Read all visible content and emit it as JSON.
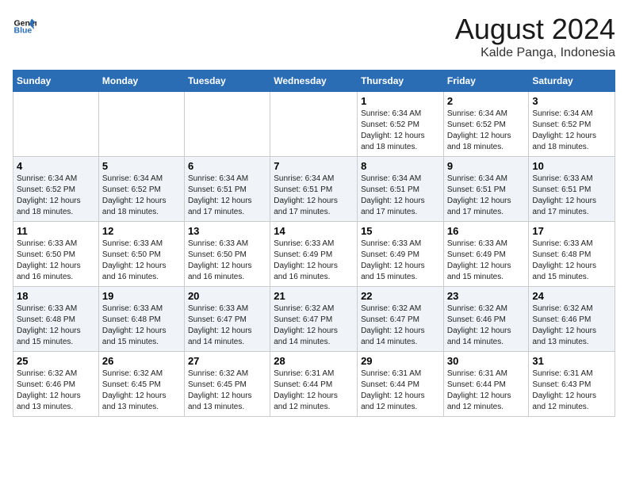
{
  "header": {
    "logo_line1": "General",
    "logo_line2": "Blue",
    "month": "August 2024",
    "location": "Kalde Panga, Indonesia"
  },
  "weekdays": [
    "Sunday",
    "Monday",
    "Tuesday",
    "Wednesday",
    "Thursday",
    "Friday",
    "Saturday"
  ],
  "weeks": [
    [
      {
        "day": "",
        "info": ""
      },
      {
        "day": "",
        "info": ""
      },
      {
        "day": "",
        "info": ""
      },
      {
        "day": "",
        "info": ""
      },
      {
        "day": "1",
        "info": "Sunrise: 6:34 AM\nSunset: 6:52 PM\nDaylight: 12 hours\nand 18 minutes."
      },
      {
        "day": "2",
        "info": "Sunrise: 6:34 AM\nSunset: 6:52 PM\nDaylight: 12 hours\nand 18 minutes."
      },
      {
        "day": "3",
        "info": "Sunrise: 6:34 AM\nSunset: 6:52 PM\nDaylight: 12 hours\nand 18 minutes."
      }
    ],
    [
      {
        "day": "4",
        "info": "Sunrise: 6:34 AM\nSunset: 6:52 PM\nDaylight: 12 hours\nand 18 minutes."
      },
      {
        "day": "5",
        "info": "Sunrise: 6:34 AM\nSunset: 6:52 PM\nDaylight: 12 hours\nand 18 minutes."
      },
      {
        "day": "6",
        "info": "Sunrise: 6:34 AM\nSunset: 6:51 PM\nDaylight: 12 hours\nand 17 minutes."
      },
      {
        "day": "7",
        "info": "Sunrise: 6:34 AM\nSunset: 6:51 PM\nDaylight: 12 hours\nand 17 minutes."
      },
      {
        "day": "8",
        "info": "Sunrise: 6:34 AM\nSunset: 6:51 PM\nDaylight: 12 hours\nand 17 minutes."
      },
      {
        "day": "9",
        "info": "Sunrise: 6:34 AM\nSunset: 6:51 PM\nDaylight: 12 hours\nand 17 minutes."
      },
      {
        "day": "10",
        "info": "Sunrise: 6:33 AM\nSunset: 6:51 PM\nDaylight: 12 hours\nand 17 minutes."
      }
    ],
    [
      {
        "day": "11",
        "info": "Sunrise: 6:33 AM\nSunset: 6:50 PM\nDaylight: 12 hours\nand 16 minutes."
      },
      {
        "day": "12",
        "info": "Sunrise: 6:33 AM\nSunset: 6:50 PM\nDaylight: 12 hours\nand 16 minutes."
      },
      {
        "day": "13",
        "info": "Sunrise: 6:33 AM\nSunset: 6:50 PM\nDaylight: 12 hours\nand 16 minutes."
      },
      {
        "day": "14",
        "info": "Sunrise: 6:33 AM\nSunset: 6:49 PM\nDaylight: 12 hours\nand 16 minutes."
      },
      {
        "day": "15",
        "info": "Sunrise: 6:33 AM\nSunset: 6:49 PM\nDaylight: 12 hours\nand 15 minutes."
      },
      {
        "day": "16",
        "info": "Sunrise: 6:33 AM\nSunset: 6:49 PM\nDaylight: 12 hours\nand 15 minutes."
      },
      {
        "day": "17",
        "info": "Sunrise: 6:33 AM\nSunset: 6:48 PM\nDaylight: 12 hours\nand 15 minutes."
      }
    ],
    [
      {
        "day": "18",
        "info": "Sunrise: 6:33 AM\nSunset: 6:48 PM\nDaylight: 12 hours\nand 15 minutes."
      },
      {
        "day": "19",
        "info": "Sunrise: 6:33 AM\nSunset: 6:48 PM\nDaylight: 12 hours\nand 15 minutes."
      },
      {
        "day": "20",
        "info": "Sunrise: 6:33 AM\nSunset: 6:47 PM\nDaylight: 12 hours\nand 14 minutes."
      },
      {
        "day": "21",
        "info": "Sunrise: 6:32 AM\nSunset: 6:47 PM\nDaylight: 12 hours\nand 14 minutes."
      },
      {
        "day": "22",
        "info": "Sunrise: 6:32 AM\nSunset: 6:47 PM\nDaylight: 12 hours\nand 14 minutes."
      },
      {
        "day": "23",
        "info": "Sunrise: 6:32 AM\nSunset: 6:46 PM\nDaylight: 12 hours\nand 14 minutes."
      },
      {
        "day": "24",
        "info": "Sunrise: 6:32 AM\nSunset: 6:46 PM\nDaylight: 12 hours\nand 13 minutes."
      }
    ],
    [
      {
        "day": "25",
        "info": "Sunrise: 6:32 AM\nSunset: 6:46 PM\nDaylight: 12 hours\nand 13 minutes."
      },
      {
        "day": "26",
        "info": "Sunrise: 6:32 AM\nSunset: 6:45 PM\nDaylight: 12 hours\nand 13 minutes."
      },
      {
        "day": "27",
        "info": "Sunrise: 6:32 AM\nSunset: 6:45 PM\nDaylight: 12 hours\nand 13 minutes."
      },
      {
        "day": "28",
        "info": "Sunrise: 6:31 AM\nSunset: 6:44 PM\nDaylight: 12 hours\nand 12 minutes."
      },
      {
        "day": "29",
        "info": "Sunrise: 6:31 AM\nSunset: 6:44 PM\nDaylight: 12 hours\nand 12 minutes."
      },
      {
        "day": "30",
        "info": "Sunrise: 6:31 AM\nSunset: 6:44 PM\nDaylight: 12 hours\nand 12 minutes."
      },
      {
        "day": "31",
        "info": "Sunrise: 6:31 AM\nSunset: 6:43 PM\nDaylight: 12 hours\nand 12 minutes."
      }
    ]
  ]
}
